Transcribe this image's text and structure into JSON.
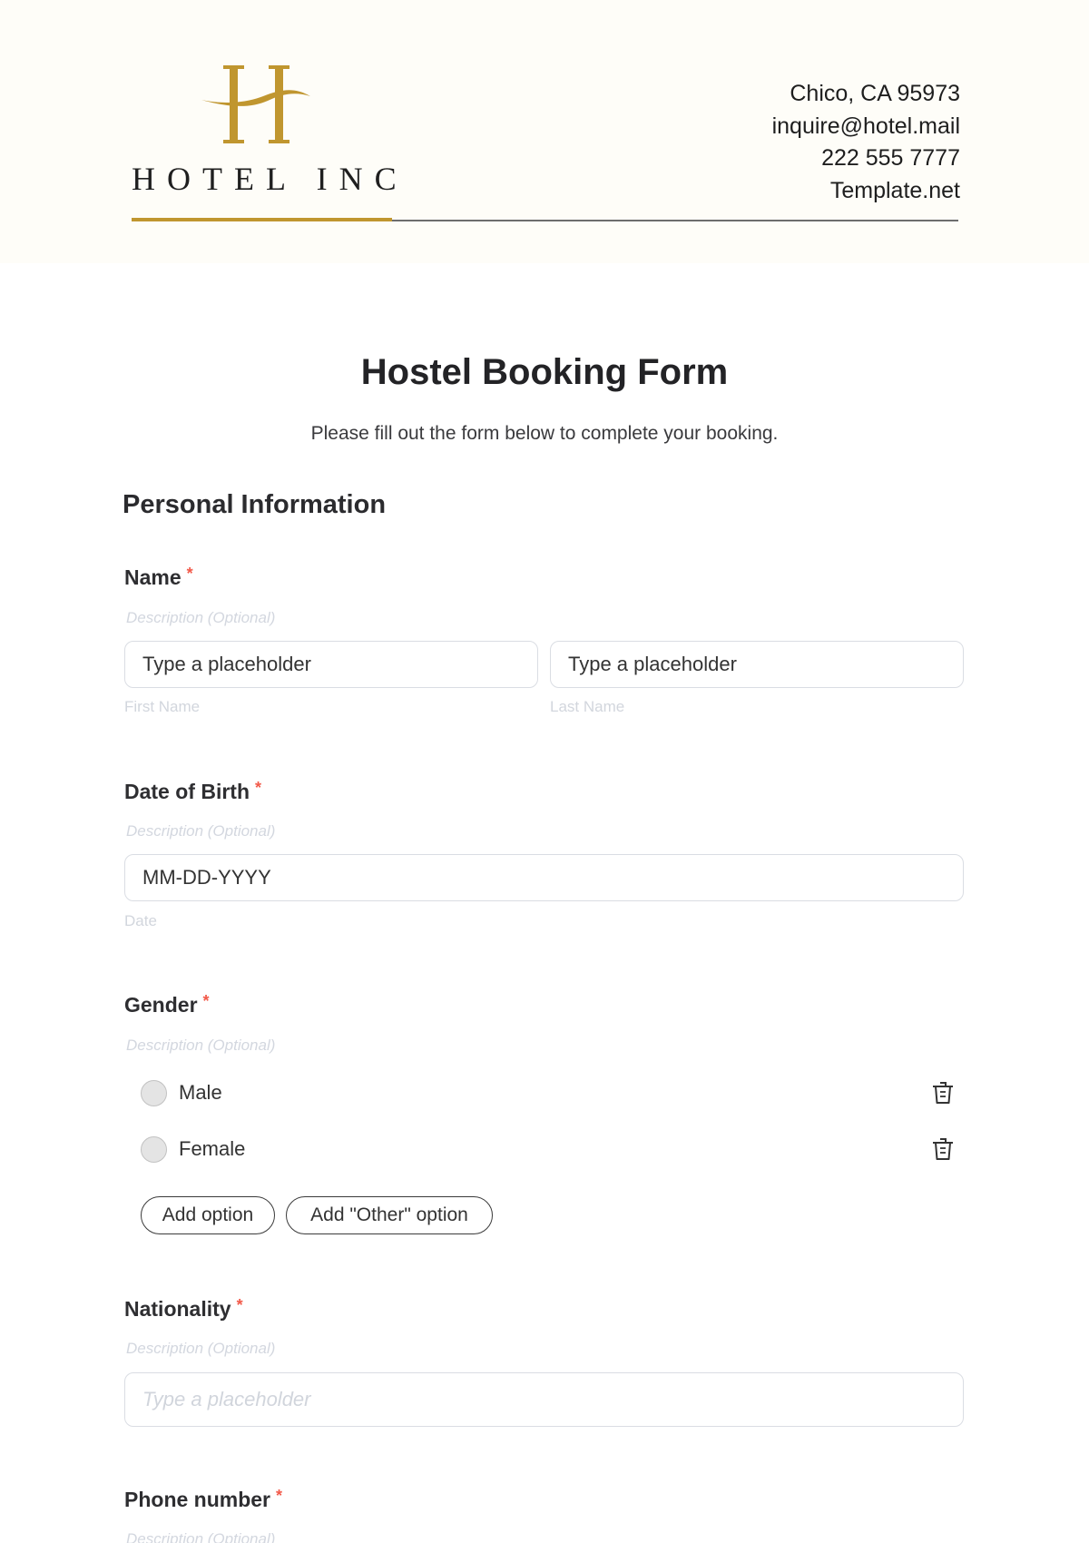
{
  "header": {
    "logo_text": "HOTEL INC",
    "brand_color": "#c0962f",
    "contact": {
      "address": "Chico, CA 95973",
      "email": "inquire@hotel.mail",
      "phone": "222 555 7777",
      "website": "Template.net"
    }
  },
  "form": {
    "title": "Hostel Booking Form",
    "subtitle": "Please fill out the form below to complete your booking.",
    "required_marker": "*",
    "sections": [
      {
        "title": "Personal Information",
        "fields": [
          {
            "label": "Name",
            "required": true,
            "description": "Description (Optional)",
            "inputs": [
              {
                "value": "Type a placeholder",
                "sub_label": "First Name"
              },
              {
                "value": "Type a placeholder",
                "sub_label": "Last Name"
              }
            ]
          },
          {
            "label": "Date of Birth",
            "required": true,
            "description": "Description (Optional)",
            "inputs": [
              {
                "value": "MM-DD-YYYY",
                "sub_label": "Date"
              }
            ]
          },
          {
            "label": "Gender",
            "required": true,
            "description": "Description (Optional)",
            "options": [
              {
                "label": "Male",
                "icon": "trash-icon"
              },
              {
                "label": "Female",
                "icon": "trash-icon"
              }
            ],
            "buttons": {
              "add_option": "Add option",
              "add_other_option": "Add \"Other\" option"
            }
          },
          {
            "label": "Nationality",
            "required": true,
            "description": "Description (Optional)",
            "inputs": [
              {
                "placeholder": "Type a placeholder"
              }
            ]
          },
          {
            "label": "Phone number",
            "required": true,
            "description": "Description (Optional)"
          }
        ]
      }
    ]
  }
}
